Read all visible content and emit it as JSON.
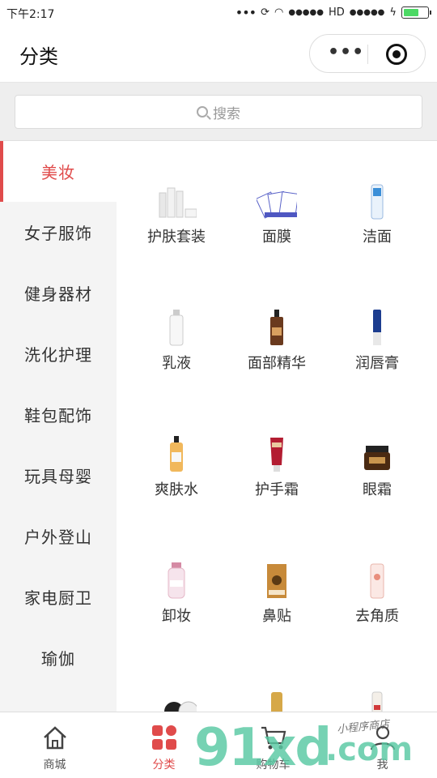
{
  "status_bar": {
    "time": "下午2:17",
    "signal_left": "•••",
    "carrier_dots": "●●●●●",
    "network": "HD",
    "carrier_dots_2": "●●●●●",
    "battery_level": 0.7
  },
  "nav": {
    "title": "分类",
    "more_label": "•••"
  },
  "search": {
    "placeholder": "搜索"
  },
  "sidebar": {
    "items": [
      {
        "label": "美妆",
        "active": true
      },
      {
        "label": "女子服饰",
        "active": false
      },
      {
        "label": "健身器材",
        "active": false
      },
      {
        "label": "洗化护理",
        "active": false
      },
      {
        "label": "鞋包配饰",
        "active": false
      },
      {
        "label": "玩具母婴",
        "active": false
      },
      {
        "label": "户外登山",
        "active": false
      },
      {
        "label": "家电厨卫",
        "active": false
      },
      {
        "label": "瑜伽",
        "active": false
      }
    ]
  },
  "products": [
    {
      "label": "护肤套装",
      "icon": "skincare-set-icon"
    },
    {
      "label": "面膜",
      "icon": "face-mask-icon"
    },
    {
      "label": "洁面",
      "icon": "cleanser-icon"
    },
    {
      "label": "乳液",
      "icon": "lotion-icon"
    },
    {
      "label": "面部精华",
      "icon": "serum-icon"
    },
    {
      "label": "润唇膏",
      "icon": "lip-balm-icon"
    },
    {
      "label": "爽肤水",
      "icon": "toner-icon"
    },
    {
      "label": "护手霜",
      "icon": "hand-cream-icon"
    },
    {
      "label": "眼霜",
      "icon": "eye-cream-icon"
    },
    {
      "label": "卸妆",
      "icon": "makeup-remover-icon"
    },
    {
      "label": "鼻贴",
      "icon": "nose-strip-icon"
    },
    {
      "label": "去角质",
      "icon": "exfoliator-icon"
    },
    {
      "label": "",
      "icon": "partial-product-icon"
    },
    {
      "label": "",
      "icon": "partial-sunscreen-icon"
    },
    {
      "label": "",
      "icon": "partial-bottle-icon"
    }
  ],
  "tab_bar": {
    "items": [
      {
        "label": "商城",
        "icon": "home-icon",
        "active": false
      },
      {
        "label": "分类",
        "icon": "category-icon",
        "active": true
      },
      {
        "label": "购物车",
        "icon": "cart-icon",
        "active": false
      },
      {
        "label": "我",
        "icon": "profile-icon",
        "active": false
      }
    ]
  },
  "watermark": {
    "main": "91xd",
    "domain": ".com",
    "sub": "小程序商店"
  },
  "colors": {
    "accent": "#e04b4b",
    "sidebar_bg": "#f4f4f4",
    "search_area_bg": "#eeeeee",
    "watermark": "#58c9a3"
  }
}
